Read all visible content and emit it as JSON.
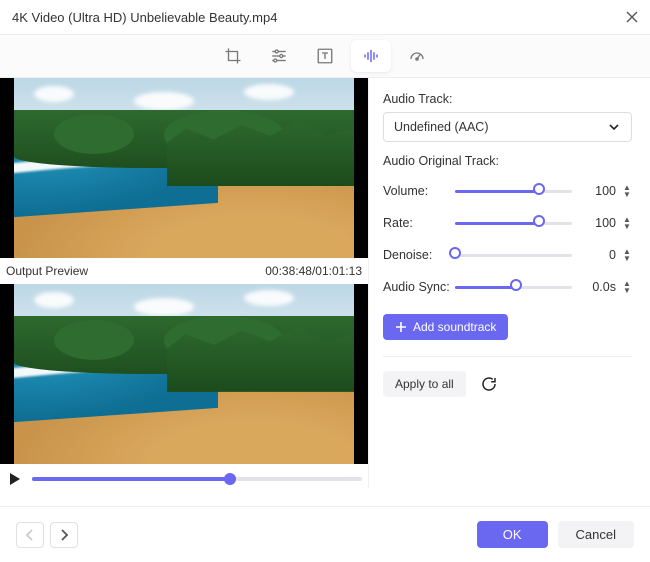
{
  "window": {
    "title": "4K Video (Ultra HD) Unbelievable Beauty.mp4"
  },
  "toolbar": {
    "crop_icon": "crop-icon",
    "adjust_icon": "sliders-icon",
    "text_icon": "text-icon",
    "audio_icon": "audio-waveform-icon",
    "speed_icon": "speedometer-icon"
  },
  "preview": {
    "output_label": "Output Preview",
    "timecode": "00:38:48/01:01:13"
  },
  "audio": {
    "track_label": "Audio Track:",
    "track_value": "Undefined (AAC)",
    "original_label": "Audio Original Track:",
    "volume_label": "Volume:",
    "volume_value": "100",
    "volume_pct": 72,
    "rate_label": "Rate:",
    "rate_value": "100",
    "rate_pct": 72,
    "denoise_label": "Denoise:",
    "denoise_value": "0",
    "denoise_pct": 0,
    "sync_label": "Audio Sync:",
    "sync_value": "0.0s",
    "sync_pct": 52,
    "add_soundtrack": "Add soundtrack"
  },
  "apply_all": "Apply to all",
  "footer": {
    "ok": "OK",
    "cancel": "Cancel"
  },
  "progress_pct": 60
}
